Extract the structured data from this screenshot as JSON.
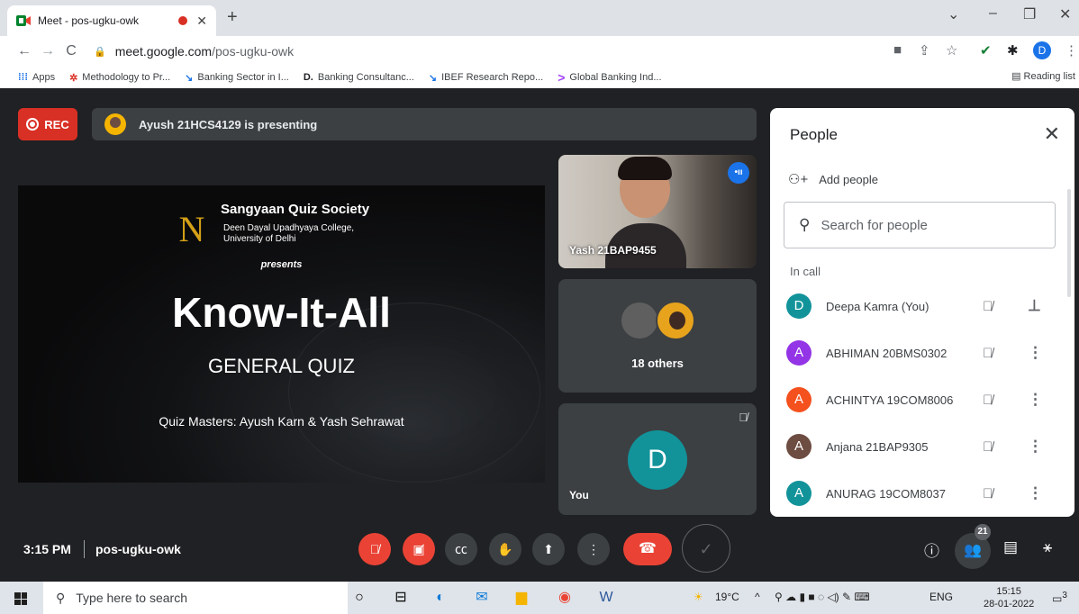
{
  "browser": {
    "tab_title": "Meet - pos-ugku-owk",
    "tab_close": "✕",
    "new_tab": "+",
    "url_host": "meet.google.com",
    "url_path": "/pos-ugku-owk",
    "profile_initial": "D",
    "bookmarks": [
      {
        "icon": "apps-icon",
        "label": "Apps"
      },
      {
        "icon": "methodology-icon",
        "label": "Methodology to Pr..."
      },
      {
        "icon": "banking-icon",
        "label": "Banking Sector in I..."
      },
      {
        "icon": "d-icon",
        "label": "Banking Consultanc..."
      },
      {
        "icon": "ibef-icon",
        "label": "IBEF Research Repo..."
      },
      {
        "icon": "global-icon",
        "label": "Global Banking Ind..."
      }
    ],
    "reading_list": "Reading list"
  },
  "meet": {
    "rec_label": "REC",
    "presenting_text": "Ayush 21HCS4129 is presenting",
    "slide": {
      "org": "Sangyaan Quiz Society",
      "college_line1": "Deen Dayal Upadhyaya College,",
      "college_line2": "University of Delhi",
      "presents": "presents",
      "title": "Know-It-All",
      "subtitle": "GENERAL QUIZ",
      "credits": "Quiz Masters: Ayush Karn & Yash Sehrawat"
    },
    "tiles": {
      "speaker_name": "Yash 21BAP9455",
      "others_label": "18 others",
      "self_initial": "D",
      "self_label": "You"
    },
    "people": {
      "title": "People",
      "add_people": "Add people",
      "search_placeholder": "Search for people",
      "section_label": "In call",
      "participants": [
        {
          "initial": "D",
          "name": "Deepa Kamra (You)",
          "color": "#12939a"
        },
        {
          "initial": "A",
          "name": "ABHIMAN 20BMS0302",
          "color": "#9334e6"
        },
        {
          "initial": "A",
          "name": "ACHINTYA 19COM8006",
          "color": "#f4511e"
        },
        {
          "initial": "A",
          "name": "Anjana 21BAP9305",
          "color": "#6d4c41"
        },
        {
          "initial": "A",
          "name": "ANURAG 19COM8037",
          "color": "#12939a"
        }
      ]
    },
    "controls": {
      "time": "3:15 PM",
      "meeting_code": "pos-ugku-owk",
      "people_count": "21"
    }
  },
  "taskbar": {
    "search_placeholder": "Type here to search",
    "weather": "19°C",
    "language": "ENG",
    "time": "15:15",
    "date": "28-01-2022",
    "notifications": "3"
  },
  "colors": {
    "meet_bg": "#202124",
    "rec_red": "#d93025",
    "self_avatar": "#12939a",
    "end_call": "#ea4335"
  }
}
